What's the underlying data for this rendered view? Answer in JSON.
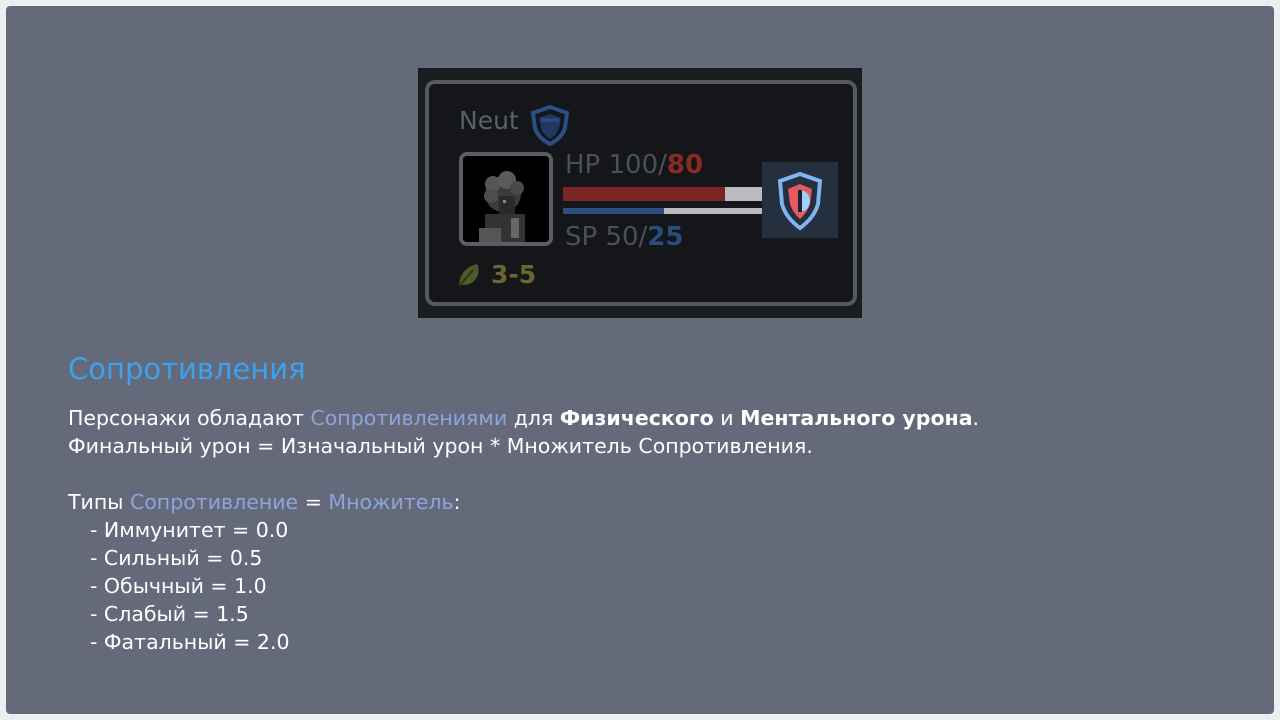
{
  "card": {
    "class_name": "Neut",
    "class_icon": "shield-icon",
    "hp": {
      "label": "HP",
      "base": "100/",
      "current": "80",
      "fill": 0.8,
      "color": "#7a2524"
    },
    "sp": {
      "label": "SP",
      "base": "50/",
      "current": "25",
      "fill": 0.5,
      "color": "#2e4f80"
    },
    "speed_icon": "leaf-icon",
    "speed": "3-5",
    "resistance_icon": "resistance-shield-icon"
  },
  "info": {
    "title": "Сопротивления",
    "p1_a": "Персонажи обладают ",
    "p1_b": "Сопротивлениями",
    "p1_c": " для ",
    "p1_d": "Физического",
    "p1_e": " и ",
    "p1_f": "Ментального урона",
    "p1_g": ".",
    "p2": "Финальный урон = Изначальный урон * Множитель Сопротивления.",
    "types_a": "Типы ",
    "types_b": "Сопротивление",
    "types_c": " = ",
    "types_d": "Множитель",
    "types_e": ":",
    "list": [
      "- Иммунитет = 0.0",
      "- Сильный = 0.5",
      "- Обычный = 1.0",
      "- Слабый = 1.5",
      "- Фатальный = 2.0"
    ]
  },
  "colors": {
    "background": "#656a7b",
    "heading": "#3aa2ee",
    "highlight": "#8ea4da"
  }
}
